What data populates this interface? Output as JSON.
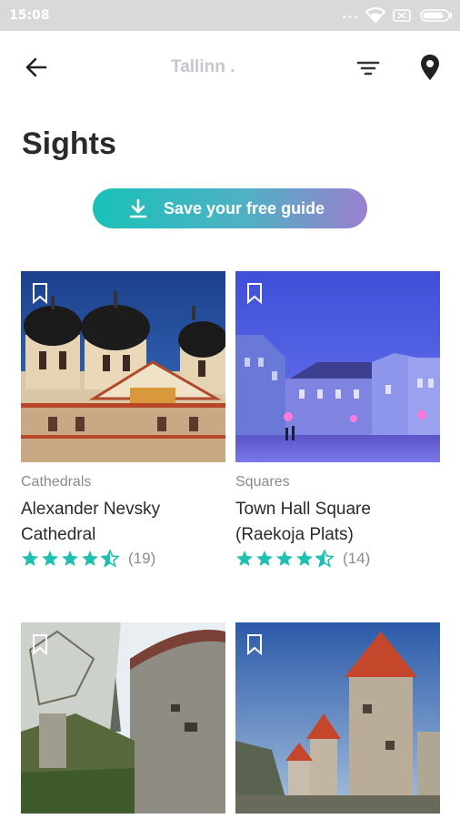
{
  "status_bar": {
    "time": "15:08",
    "dots": "...",
    "icons": [
      "wifi-icon",
      "no-sim-icon",
      "battery-icon"
    ]
  },
  "app_bar": {
    "title": "Tallinn .",
    "icons": [
      "back-arrow-icon",
      "filter-icon",
      "location-pin-icon"
    ]
  },
  "page": {
    "heading": "Sights"
  },
  "save_button": {
    "label": "Save your free guide",
    "icon": "download-icon"
  },
  "colors": {
    "accent": "#1ec0b2",
    "star": "#1ec0b2",
    "gradient_start": "#19c1b8",
    "gradient_end": "#9a7fcf"
  },
  "cards": [
    {
      "category": "Cathedrals",
      "name": "Alexander Nevsky Cathedral",
      "rating": 4.5,
      "review_count": "(19)"
    },
    {
      "category": "Squares",
      "name": "Town Hall Square (Raekoja Plats)",
      "rating": 4.5,
      "review_count": "(14)"
    },
    {
      "category": "",
      "name": "",
      "rating": null,
      "review_count": ""
    },
    {
      "category": "",
      "name": "",
      "rating": null,
      "review_count": ""
    }
  ]
}
